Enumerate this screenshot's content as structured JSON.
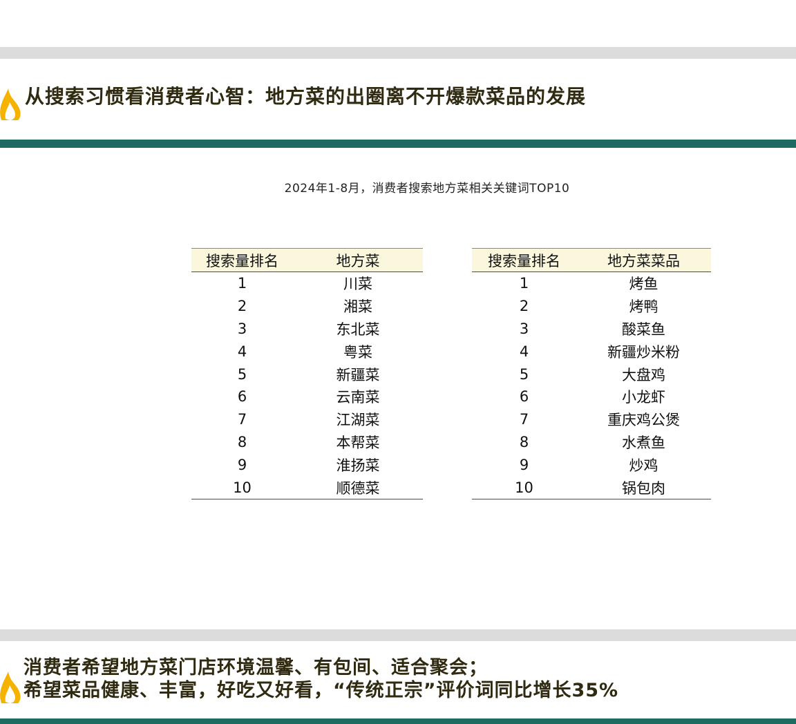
{
  "header": {
    "title": "从搜索习惯看消费者心智：地方菜的出圈离不开爆款菜品的发展"
  },
  "chart_title": "2024年1-8月，消费者搜索地方菜相关关键词TOP10",
  "cuisine_table": {
    "columns": [
      "搜索量排名",
      "地方菜"
    ],
    "rows": [
      [
        "1",
        "川菜"
      ],
      [
        "2",
        "湘菜"
      ],
      [
        "3",
        "东北菜"
      ],
      [
        "4",
        "粤菜"
      ],
      [
        "5",
        "新疆菜"
      ],
      [
        "6",
        "云南菜"
      ],
      [
        "7",
        "江湖菜"
      ],
      [
        "8",
        "本帮菜"
      ],
      [
        "9",
        "淮扬菜"
      ],
      [
        "10",
        "顺德菜"
      ]
    ]
  },
  "dish_table": {
    "columns": [
      "搜索量排名",
      "地方菜菜品"
    ],
    "rows": [
      [
        "1",
        "烤鱼"
      ],
      [
        "2",
        "烤鸭"
      ],
      [
        "3",
        "酸菜鱼"
      ],
      [
        "4",
        "新疆炒米粉"
      ],
      [
        "5",
        "大盘鸡"
      ],
      [
        "6",
        "小龙虾"
      ],
      [
        "7",
        "重庆鸡公煲"
      ],
      [
        "8",
        "水煮鱼"
      ],
      [
        "9",
        "炒鸡"
      ],
      [
        "10",
        "锅包肉"
      ]
    ]
  },
  "footer": {
    "line1": "消费者希望地方菜门店环境温馨、有包间、适合聚会；",
    "line2": "希望菜品健康、丰富，好吃又好看，“传统正宗”评价词同比增长35%"
  },
  "colors": {
    "accent_teal": "#1e6b62",
    "flame": "#f5b300",
    "table_header_bg": "#fbf7dc",
    "headline_text": "#2f2a10"
  },
  "icons": [
    "flame-icon"
  ]
}
